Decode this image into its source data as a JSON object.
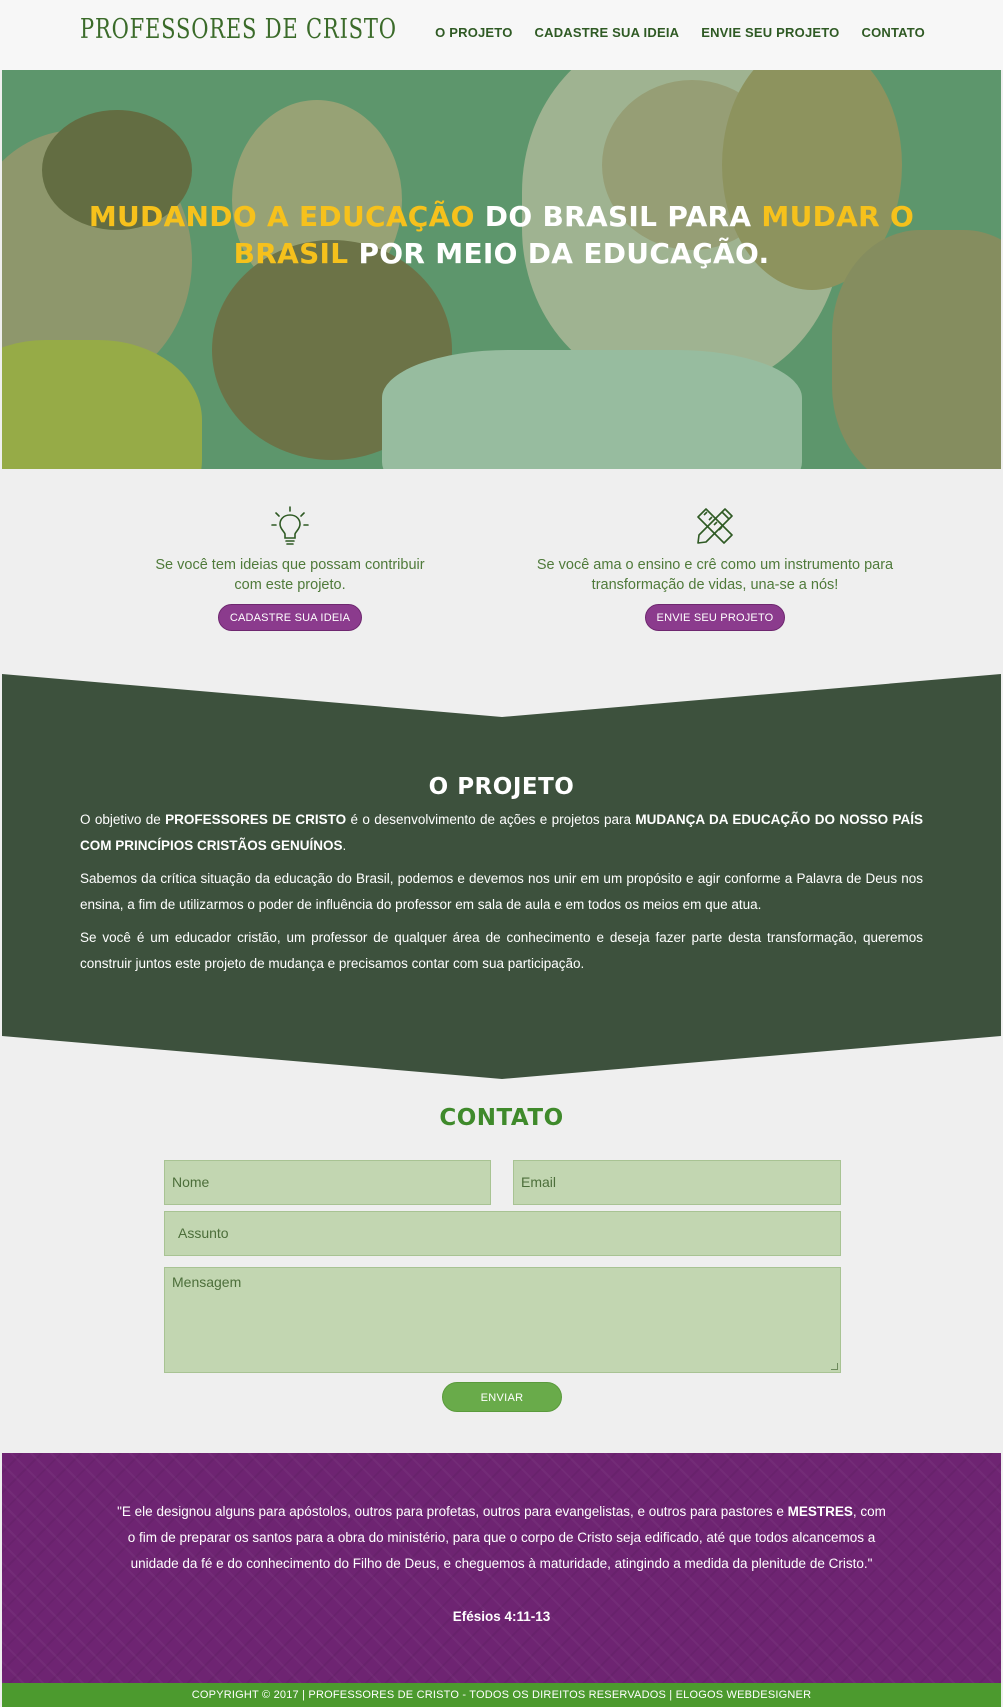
{
  "header": {
    "logo": "PROFESSORES DE CRISTO",
    "nav": [
      "O PROJETO",
      "CADASTRE SUA IDEIA",
      "ENVIE SEU PROJETO",
      "CONTATO"
    ]
  },
  "hero": {
    "title_part1": "MUDANDO A EDUCAÇÃO",
    "title_part2": " DO BRASIL PARA ",
    "title_part3": "MUDAR O BRASIL",
    "title_part4": " POR MEIO DA EDUCAÇÃO."
  },
  "features": [
    {
      "icon": "lightbulb-icon",
      "text": "Se você tem ideias que possam contribuir com este projeto.",
      "button": "CADASTRE SUA IDEIA"
    },
    {
      "icon": "pencil-ruler-icon",
      "text": "Se você ama o ensino e crê como um instrumento para transformação de vidas, una-se a nós!",
      "button": "ENVIE SEU PROJETO"
    }
  ],
  "project": {
    "title": "O PROJETO",
    "p1_a": "O objetivo de ",
    "p1_b": "PROFESSORES DE CRISTO",
    "p1_c": " é o desenvolvimento de ações e projetos para ",
    "p1_d": "MUDANÇA DA EDUCAÇÃO DO NOSSO PAÍS COM PRINCÍPIOS CRISTÃOS GENUÍNOS",
    "p1_e": ".",
    "p2": "Sabemos da crítica situação da educação do Brasil, podemos e devemos nos unir em um propósito e agir conforme a Palavra de Deus nos ensina, a fim de utilizarmos o poder de influência do professor em sala de aula e em todos os meios em que atua.",
    "p3": "Se você é um educador cristão, um professor de qualquer área de conhecimento e deseja fazer parte desta transformação, queremos construir juntos este projeto de mudança e precisamos contar com sua participação."
  },
  "contact": {
    "title": "CONTATO",
    "name_placeholder": "Nome",
    "email_placeholder": "Email",
    "subject_placeholder": "Assunto",
    "message_placeholder": "Mensagem",
    "send_label": "ENVIAR"
  },
  "quote": {
    "text_a": "\"E ele designou alguns para apóstolos, outros para profetas, outros para evangelistas, e outros para pastores e ",
    "text_b": "MESTRES",
    "text_c": ", com o fim de preparar os santos para a obra do ministério, para que o corpo de Cristo seja edificado, até que todos alcancemos a unidade da fé e do conhecimento do Filho de Deus, e cheguemos à maturidade, atingindo a medida da plenitude de Cristo.\"",
    "reference": "Efésios 4:11-13"
  },
  "footer": {
    "text": "COPYRIGHT © 2017 | PROFESSORES DE CRISTO - TODOS OS DIREITOS RESERVADOS | ELOGOS WEBDESIGNER"
  },
  "colors": {
    "brand_green": "#3b6b2a",
    "dark_green": "#3d513d",
    "accent_purple": "#8b3b8d",
    "accent_yellow": "#f6c11c",
    "footer_green": "#4c9a2e"
  }
}
